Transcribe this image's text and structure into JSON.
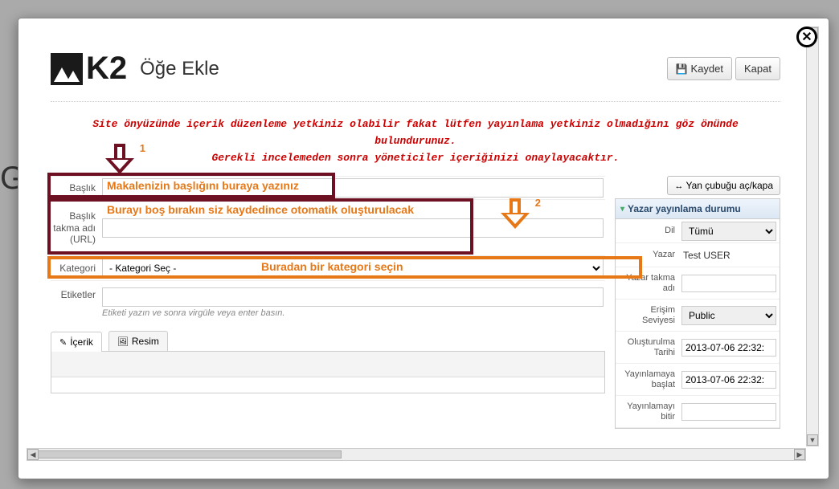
{
  "bg_heading": "G",
  "page_title": "Öğe Ekle",
  "toolbar": {
    "save": "Kaydet",
    "close": "Kapat"
  },
  "notice_lines": [
    "Site önyüzünde içerik düzenleme yetkiniz olabilir fakat lütfen yayınlama yetkiniz olmadığını göz önünde",
    "bulundurunuz.",
    "Gerekli incelemeden sonra yöneticiler içeriğinizi onaylayacaktır."
  ],
  "fields": {
    "title_label": "Başlık",
    "alias_label": "Başlık takma adı (URL)",
    "category_label": "Kategori",
    "category_option": "- Kategori Seç -",
    "tags_label": "Etiketler",
    "tags_hint": "Etiketi yazın ve sonra virgüle veya enter basın."
  },
  "tabs": {
    "content": "İçerik",
    "image": "Resim"
  },
  "sidebar_toggle": "Yan çubuğu aç/kapa",
  "sidebar": {
    "header": "Yazar yayınlama durumu",
    "lang_label": "Dil",
    "lang_value": "Tümü",
    "author_label": "Yazar",
    "author_value": "Test USER",
    "alias_label": "Yazar takma adı",
    "access_label": "Erişim Seviyesi",
    "access_value": "Public",
    "created_label": "Oluşturulma Tarihi",
    "created_value": "2013-07-06 22:32:",
    "pubstart_label": "Yayınlamaya başlat",
    "pubstart_value": "2013-07-06 22:32:",
    "pubend_label": "Yayınlamayı bitir"
  },
  "callouts": {
    "num1": "1",
    "num2": "2",
    "title_hint": "Makalenizin başlığını buraya yazınız",
    "alias_hint": "Burayı boş bırakın  siz kaydedince otomatik oluşturulacak",
    "category_hint": "Buradan bir kategori seçin"
  }
}
